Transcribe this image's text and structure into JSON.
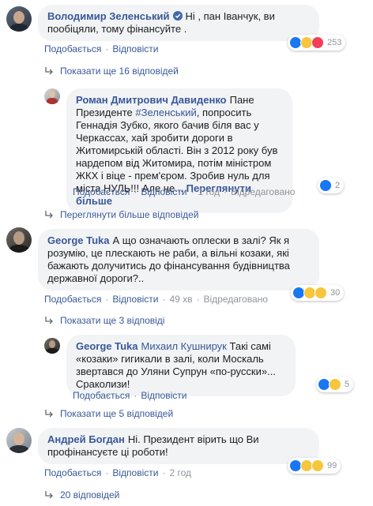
{
  "colors": {
    "link": "#385898",
    "bubble": "#f2f3f5",
    "meta": "#90949c",
    "like_blue": "#1877f2"
  },
  "actions": {
    "like": "Подобається",
    "reply": "Відповісти",
    "edited": "Відредаговано"
  },
  "comments": [
    {
      "author": "Володимир Зеленський",
      "verified": true,
      "text": "Ні , пан Іванчук, ви пообіцяли, тому фінансуйте .",
      "reaction_count": "253",
      "reaction_icons": [
        "like-icon",
        "haha-icon",
        "love-icon"
      ],
      "more_replies": "Показати ще 16 відповідей"
    },
    {
      "author": "Роман Дмитрович Давиденко",
      "pre": "Пане Президенте ",
      "hashtag": "#Зеленський",
      "text": ", попросить Геннадія Зубко, якого бачив біля вас у Черкассах, хай зробити дороги в Житомирській області. Він з 2012 року був нардепом від Житомира, потім міністром ЖКХ і віце - прем'єром. Зробив нуль для міста НУЛЬ!!! Але не... ",
      "see_more": "Переглянути більше",
      "time": "1 год",
      "reaction_count": "2",
      "reaction_icons": [
        "like-icon"
      ],
      "more_replies": "Переглянути більше відповідей"
    },
    {
      "author": "George Tuka",
      "text": "А що означають оплески в залі? Як я розумію, це плескають не раби, а вільні козаки, які бажають долучитись до фінансування будівництва державної дороги?..",
      "time": "49 хв",
      "reaction_count": "30",
      "reaction_icons": [
        "like-icon",
        "haha-icon",
        "sad-icon"
      ],
      "more_replies": "Показати ще 3 відповіді"
    },
    {
      "author": "George Tuka",
      "mention": "Михаил Кушнирук",
      "text": " Такі самі «козаки» гигикали в залі, коли Москаль звертався до Уляни Супрун «по-русски»... Сраколизи!",
      "reaction_count": "5",
      "reaction_icons": [
        "like-icon",
        "haha-icon"
      ],
      "more_replies": "Показати ще 5 відповідей"
    },
    {
      "author": "Андрей Богдан",
      "text": "Ні. Президент вірить що Ви профінансуєте ці роботи!",
      "time": "2 год",
      "reaction_count": "99",
      "reaction_icons": [
        "like-icon",
        "haha-icon",
        "wow-icon"
      ],
      "more_replies": "20 відповідей"
    }
  ]
}
